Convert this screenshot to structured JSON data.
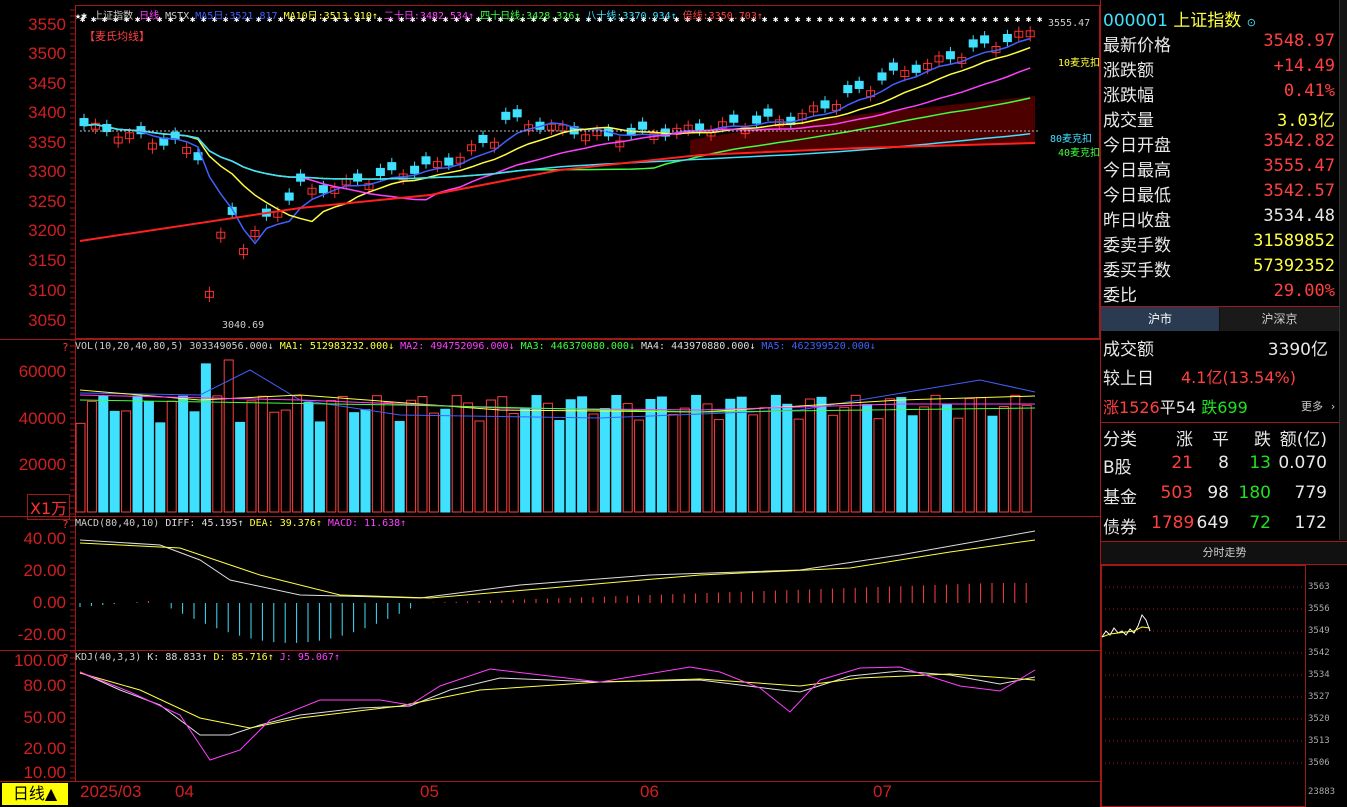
{
  "chart_header": {
    "stars": "★✱",
    "index_name": "上证指数",
    "period": "日线",
    "indicator": "MSTX",
    "ma5_label": "MA5日:",
    "ma5_value": "3521.817",
    "ma10_label": "MA10日:",
    "ma10_value": "3513.910↑",
    "ma20_label": "二十日:",
    "ma20_value": "3482.534↑",
    "ma40_label": "四十日线:",
    "ma40_value": "3428.326↑",
    "ma80_label": "八十线:",
    "ma80_value": "3370.934↑",
    "double_label": "倍线:",
    "double_value": "3350.703↑",
    "badge": "【麦氏均线】",
    "high_mark": "3555.47",
    "low_mark": "3040.69",
    "line_label_10": "10麦克扣",
    "line_label_80": "80麦克扣",
    "line_label_40": "40麦克扣"
  },
  "vol_header": {
    "title": "VOL(10,20,40,80,5)",
    "value": "303349056.000↓",
    "ma1": "MA1: 512983232.000↓",
    "ma2": "MA2: 494752096.000↓",
    "ma3": "MA3: 446370080.000↓",
    "ma4": "MA4: 443970880.000↓",
    "ma5": "MA5: 462399520.000↓",
    "unit": "X1万"
  },
  "macd_header": {
    "title": "MACD(80,40,10)",
    "diff": "DIFF: 45.195↑",
    "dea": "DEA: 39.376↑",
    "macd": "MACD: 11.638↑"
  },
  "kdj_header": {
    "title": "KDJ(40,3,3)",
    "k": "K: 88.833↑",
    "d": "D: 85.716↑",
    "j": "J: 95.067↑"
  },
  "price_ticks": [
    "3550",
    "3500",
    "3450",
    "3400",
    "3350",
    "3300",
    "3250",
    "3200",
    "3150",
    "3100",
    "3050"
  ],
  "vol_ticks": [
    "60000",
    "40000",
    "20000"
  ],
  "macd_ticks": [
    "40.00",
    "20.00",
    "0.00",
    "-20.00"
  ],
  "kdj_ticks": [
    "100.00",
    "80.00",
    "50.00",
    "20.00",
    "10.00"
  ],
  "x_axis": {
    "labels": [
      "2025/03",
      "04",
      "05",
      "06",
      "07"
    ],
    "period_button": "日线▲"
  },
  "quote": {
    "code": "000001",
    "name": "上证指数",
    "rows": [
      {
        "label": "最新价格",
        "value": "3548.97",
        "color": "red"
      },
      {
        "label": "涨跌额",
        "value": "+14.49",
        "color": "red"
      },
      {
        "label": "涨跌幅",
        "value": "0.41%",
        "color": "red"
      },
      {
        "label": "成交量",
        "value": "3.03亿",
        "color": "yellow"
      },
      {
        "label": "今日开盘",
        "value": "3542.82",
        "color": "red"
      },
      {
        "label": "今日最高",
        "value": "3555.47",
        "color": "red"
      },
      {
        "label": "今日最低",
        "value": "3542.57",
        "color": "red"
      },
      {
        "label": "昨日收盘",
        "value": "3534.48",
        "color": "white"
      },
      {
        "label": "委卖手数",
        "value": "31589852",
        "color": "yellow"
      },
      {
        "label": "委买手数",
        "value": "57392352",
        "color": "yellow"
      },
      {
        "label": "委比",
        "value": "29.00%",
        "color": "red"
      }
    ],
    "tabs": [
      "沪市",
      "沪深京"
    ],
    "turnover_label": "成交额",
    "turnover_value": "3390亿",
    "compare_label": "较上日",
    "compare_value": "4.1亿(13.54%)",
    "up_label": "涨",
    "up_value": "1526",
    "flat_label": "平",
    "flat_value": "54",
    "down_label": "跌",
    "down_value": "699",
    "more": "更多 ›",
    "table_headers": [
      "分类",
      "涨",
      "平",
      "跌",
      "额(亿)"
    ],
    "table_rows": [
      {
        "cat": "B股",
        "up": "21",
        "flat": "8",
        "down": "13",
        "amt": "0.070"
      },
      {
        "cat": "基金",
        "up": "503",
        "flat": "98",
        "down": "180",
        "amt": "779"
      },
      {
        "cat": "债券",
        "up": "1789",
        "flat": "649",
        "down": "72",
        "amt": "172"
      }
    ],
    "intraday_title": "分时走势",
    "intraday_ticks": [
      "3563",
      "3556",
      "3549",
      "3542",
      "3534",
      "3527",
      "3520",
      "3513",
      "3506",
      "23883"
    ]
  }
}
